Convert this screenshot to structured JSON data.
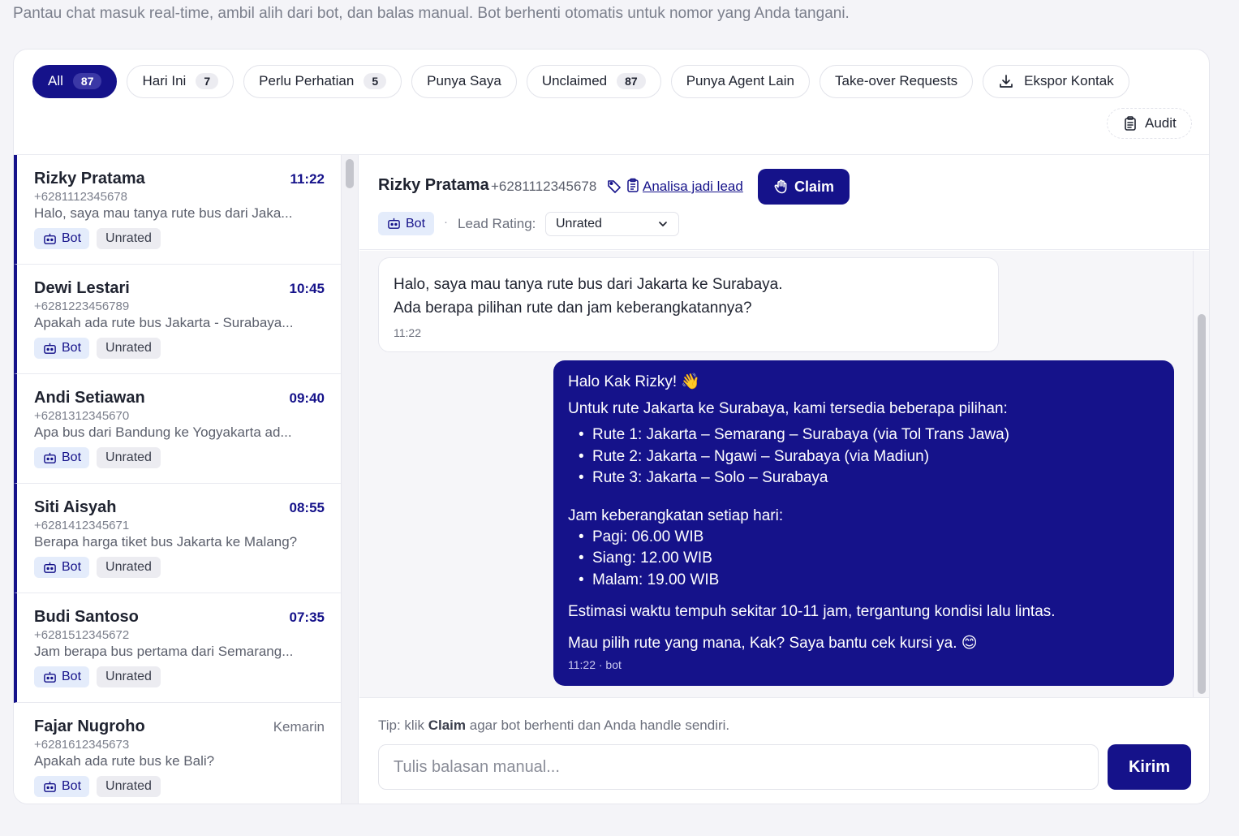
{
  "page": {
    "subtitle": "Pantau chat masuk real-time, ambil alih dari bot, dan balas manual. Bot berhenti otomatis untuk nomor yang Anda tangani."
  },
  "filters": [
    {
      "label": "All",
      "count": "87"
    },
    {
      "label": "Hari Ini",
      "count": "7"
    },
    {
      "label": "Perlu Perhatian",
      "count": "5"
    },
    {
      "label": "Punya Saya"
    },
    {
      "label": "Unclaimed",
      "count": "87"
    },
    {
      "label": "Punya Agent Lain"
    },
    {
      "label": "Take-over Requests"
    },
    {
      "label": "Ekspor Kontak"
    }
  ],
  "audit_label": "Audit",
  "conversations": [
    {
      "name": "Rizky Pratama",
      "time": "11:22",
      "phone": "+6281112345678",
      "preview": "Halo, saya mau tanya rute bus dari Jaka...",
      "bot": "Bot",
      "rating": "Unrated"
    },
    {
      "name": "Dewi Lestari",
      "time": "10:45",
      "phone": "+6281223456789",
      "preview": "Apakah ada rute bus Jakarta - Surabaya...",
      "bot": "Bot",
      "rating": "Unrated"
    },
    {
      "name": "Andi Setiawan",
      "time": "09:40",
      "phone": "+6281312345670",
      "preview": "Apa bus dari Bandung ke Yogyakarta ad...",
      "bot": "Bot",
      "rating": "Unrated"
    },
    {
      "name": "Siti Aisyah",
      "time": "08:55",
      "phone": "+6281412345671",
      "preview": "Berapa harga tiket bus Jakarta ke Malang?",
      "bot": "Bot",
      "rating": "Unrated"
    },
    {
      "name": "Budi Santoso",
      "time": "07:35",
      "phone": "+6281512345672",
      "preview": "Jam berapa bus pertama dari Semarang...",
      "bot": "Bot",
      "rating": "Unrated"
    },
    {
      "name": "Fajar Nugroho",
      "time": "Kemarin",
      "phone": "+6281612345673",
      "preview": "Apakah ada rute bus ke Bali?",
      "bot": "Bot",
      "rating": "Unrated"
    }
  ],
  "chat": {
    "name": "Rizky Pratama",
    "phone": "+6281112345678",
    "lead_link": "Analisa jadi lead",
    "claim_label": "Claim",
    "bot_tag": "Bot",
    "dot": "·",
    "rating_label": "Lead Rating:",
    "rating_value": "Unrated",
    "incoming": {
      "line1": "Halo, saya mau tanya rute bus dari Jakarta ke Surabaya.",
      "line2": "Ada berapa pilihan rute dan jam keberangkatannya?",
      "time": "11:22"
    },
    "outgoing": {
      "greeting": "Halo Kak Rizky! 👋",
      "intro": "Untuk rute Jakarta ke Surabaya, kami tersedia beberapa pilihan:",
      "routes": [
        "Rute 1: Jakarta – Semarang – Surabaya (via Tol Trans Jawa)",
        "Rute 2: Jakarta – Ngawi – Surabaya (via Madiun)",
        "Rute 3: Jakarta – Solo – Surabaya"
      ],
      "schedule_title": "Jam keberangkatan setiap hari:",
      "schedule": [
        "Pagi: 06.00 WIB",
        "Siang: 12.00 WIB",
        "Malam: 19.00 WIB"
      ],
      "estimate": "Estimasi waktu tempuh sekitar 10-11 jam, tergantung kondisi lalu lintas.",
      "closing": "Mau pilih rute yang mana, Kak? Saya bantu cek kursi ya. 😊",
      "meta": "11:22 · bot"
    }
  },
  "composer": {
    "tip_prefix": "Tip: klik ",
    "tip_bold": "Claim",
    "tip_suffix": " agar bot berhenti dan Anda handle sendiri.",
    "placeholder": "Tulis balasan manual...",
    "send_label": "Kirim"
  },
  "colors": {
    "accent": "#15128a",
    "bot_tag_bg": "#e4ecfb",
    "unrated_bg": "#ececf1",
    "page_bg": "#f4f4f8"
  }
}
